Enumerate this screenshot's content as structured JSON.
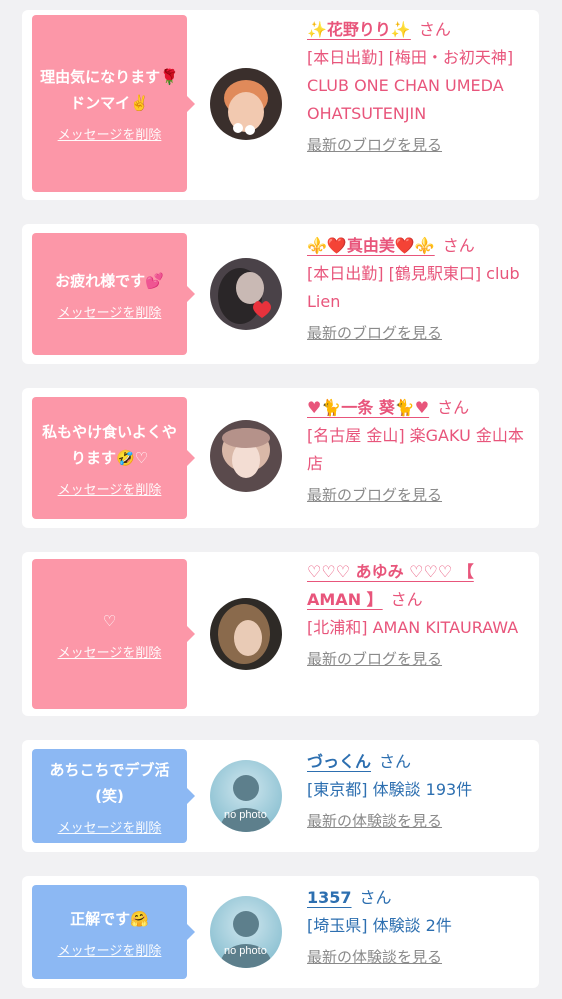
{
  "cards": [
    {
      "message": "理由気になります🌹ドンマイ✌️",
      "delete_label": "メッセージを削除",
      "name": "✨花野りり✨",
      "san": "さん",
      "meta": "[本日出勤] [梅田・お初天神] CLUB ONE CHAN UMEDA OHATSUTENJIN",
      "link": "最新のブログを見る",
      "theme": "pink"
    },
    {
      "message": "お疲れ様です💕",
      "delete_label": "メッセージを削除",
      "name": "⚜️❤️真由美❤️⚜️",
      "san": "さん",
      "meta": "[本日出勤] [鶴見駅東口] club Lien",
      "link": "最新のブログを見る",
      "theme": "pink"
    },
    {
      "message": "私もやけ食いよくやります🤣♡",
      "delete_label": "メッセージを削除",
      "name": "♥🐈一条 葵🐈♥",
      "san": "さん",
      "meta": "[名古屋 金山] 楽GAKU 金山本店",
      "link": "最新のブログを見る",
      "theme": "pink"
    },
    {
      "message": "♡",
      "delete_label": "メッセージを削除",
      "name": "♡♡♡ あゆみ ♡♡♡ 【 AMAN 】",
      "san": "さん",
      "meta": "[北浦和] AMAN KITAURAWA",
      "link": "最新のブログを見る",
      "theme": "pink"
    },
    {
      "message": "あちこちでデブ活(笑)",
      "delete_label": "メッセージを削除",
      "name": "づっくん",
      "san": "さん",
      "meta": "[東京都] 体験談 193件",
      "link": "最新の体験談を見る",
      "theme": "blue",
      "avatar_text": "no photo"
    },
    {
      "message": "正解です🤗",
      "delete_label": "メッセージを削除",
      "name": "1357",
      "san": "さん",
      "meta": "[埼玉県] 体験談 2件",
      "link": "最新の体験談を見る",
      "theme": "blue",
      "avatar_text": "no photo"
    }
  ],
  "colors": {
    "pink_bubble": "#fc97a8",
    "blue_bubble": "#8cb8f3",
    "pink_text": "#e8557b",
    "blue_text": "#2d6fb0",
    "link_gray": "#8a8a8a"
  }
}
